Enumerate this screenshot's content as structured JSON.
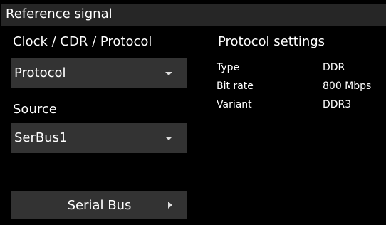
{
  "header": {
    "title": "Reference signal"
  },
  "clock_section": {
    "label": "Clock / CDR / Protocol",
    "selected": "Protocol"
  },
  "source_section": {
    "label": "Source",
    "selected": "SerBus1"
  },
  "serial_button": {
    "label": "Serial Bus"
  },
  "protocol_settings": {
    "title": "Protocol settings",
    "rows": [
      {
        "key": "Type",
        "value": "DDR"
      },
      {
        "key": "Bit rate",
        "value": "800 Mbps"
      },
      {
        "key": "Variant",
        "value": "DDR3"
      }
    ]
  },
  "colors": {
    "background": "#000000",
    "header": "#262626",
    "control": "#333333",
    "text": "#ffffff"
  },
  "icons": {
    "dropdown": "chevron-down-icon",
    "submenu": "chevron-right-icon"
  }
}
